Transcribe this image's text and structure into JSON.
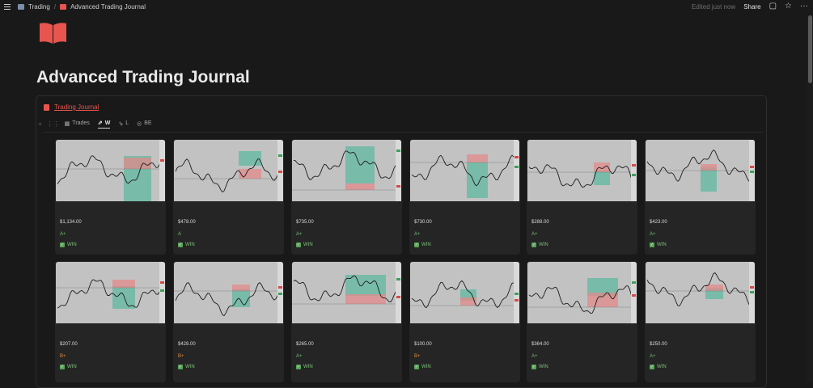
{
  "topbar": {
    "breadcrumb": [
      {
        "label": "Trading",
        "icon": "chart-icon"
      },
      {
        "label": "Advanced Trading Journal",
        "icon": "book-icon"
      }
    ],
    "edited": "Edited just now",
    "share": "Share"
  },
  "page": {
    "title": "Advanced Trading Journal"
  },
  "database": {
    "title": "Trading Journal",
    "tabs": [
      {
        "label": "Trades",
        "icon": "bar-chart-icon",
        "active": false
      },
      {
        "label": "W",
        "icon": "trend-up-icon",
        "active": true
      },
      {
        "label": "L",
        "icon": "trend-down-icon",
        "active": false
      },
      {
        "label": "BE",
        "icon": "globe-icon",
        "active": false
      }
    ],
    "cards": [
      {
        "amount": "$1,134.00",
        "grade": "A+",
        "grade_color": "#6fbf73",
        "result": "WIN"
      },
      {
        "amount": "$478.00",
        "grade": "A",
        "grade_color": "#6fbf73",
        "result": "WIN"
      },
      {
        "amount": "$735.00",
        "grade": "A+",
        "grade_color": "#6fbf73",
        "result": "WIN"
      },
      {
        "amount": "$730.00",
        "grade": "A+",
        "grade_color": "#6fbf73",
        "result": "WIN"
      },
      {
        "amount": "$288.00",
        "grade": "A+",
        "grade_color": "#6fbf73",
        "result": "WIN"
      },
      {
        "amount": "$423.00",
        "grade": "A+",
        "grade_color": "#6fbf73",
        "result": "WIN"
      },
      {
        "amount": "$207.00",
        "grade": "B+",
        "grade_color": "#e08a3c",
        "result": "WIN"
      },
      {
        "amount": "$428.00",
        "grade": "B+",
        "grade_color": "#e08a3c",
        "result": "WIN"
      },
      {
        "amount": "$265.00",
        "grade": "A+",
        "grade_color": "#6fbf73",
        "result": "WIN"
      },
      {
        "amount": "$100.00",
        "grade": "B+",
        "grade_color": "#e08a3c",
        "result": "WIN"
      },
      {
        "amount": "$364.00",
        "grade": "A+",
        "grade_color": "#6fbf73",
        "result": "WIN"
      },
      {
        "amount": "$250.00",
        "grade": "A+",
        "grade_color": "#6fbf73",
        "result": "WIN"
      }
    ]
  },
  "colors": {
    "accent": "#e8554e",
    "win": "#7ec07a",
    "zone_green": "#5fb8a0",
    "zone_red": "#e38a8a"
  }
}
